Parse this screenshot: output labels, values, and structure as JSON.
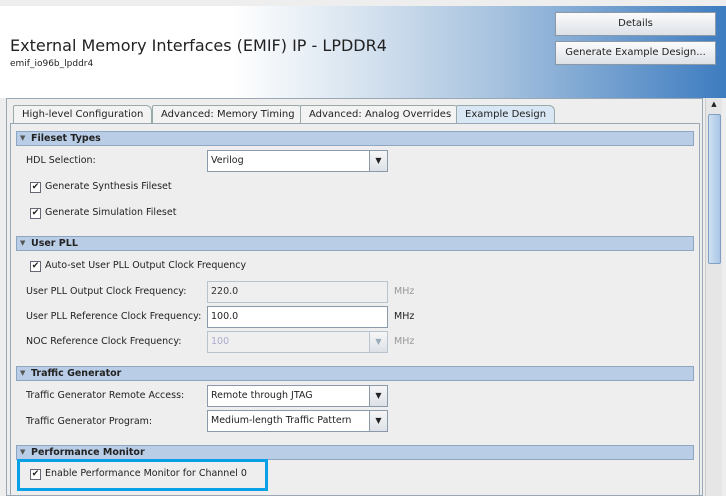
{
  "header": {
    "title": "External Memory Interfaces (EMIF) IP - LPDDR4",
    "subtitle": "emif_io96b_lpddr4",
    "details_button": "Details",
    "generate_button": "Generate Example Design..."
  },
  "tabs": [
    {
      "label": "High-level Configuration"
    },
    {
      "label": "Advanced: Memory Timing"
    },
    {
      "label": "Advanced: Analog Overrides"
    },
    {
      "label": "Example Design",
      "active": true
    }
  ],
  "fileset": {
    "title": "Fileset Types",
    "hdl_label": "HDL Selection:",
    "hdl_value": "Verilog",
    "synth_label": "Generate Synthesis Fileset",
    "synth_checked": true,
    "sim_label": "Generate Simulation Fileset",
    "sim_checked": true
  },
  "pll": {
    "title": "User PLL",
    "autoset_label": "Auto-set User PLL Output Clock Frequency",
    "autoset_checked": true,
    "out_label": "User PLL Output Clock Frequency:",
    "out_value": "220.0",
    "ref_label": "User PLL Reference Clock Frequency:",
    "ref_value": "100.0",
    "noc_label": "NOC Reference Clock Frequency:",
    "noc_value": "100",
    "unit": "MHz"
  },
  "traffic": {
    "title": "Traffic Generator",
    "remote_label": "Traffic Generator Remote Access:",
    "remote_value": "Remote through JTAG",
    "program_label": "Traffic Generator Program:",
    "program_value": "Medium-length Traffic Pattern"
  },
  "perf": {
    "title": "Performance Monitor",
    "enable_label": "Enable Performance Monitor for Channel 0",
    "enable_checked": true
  },
  "colors": {
    "highlight": "#0aa0e6",
    "section": "#b9cee6"
  }
}
